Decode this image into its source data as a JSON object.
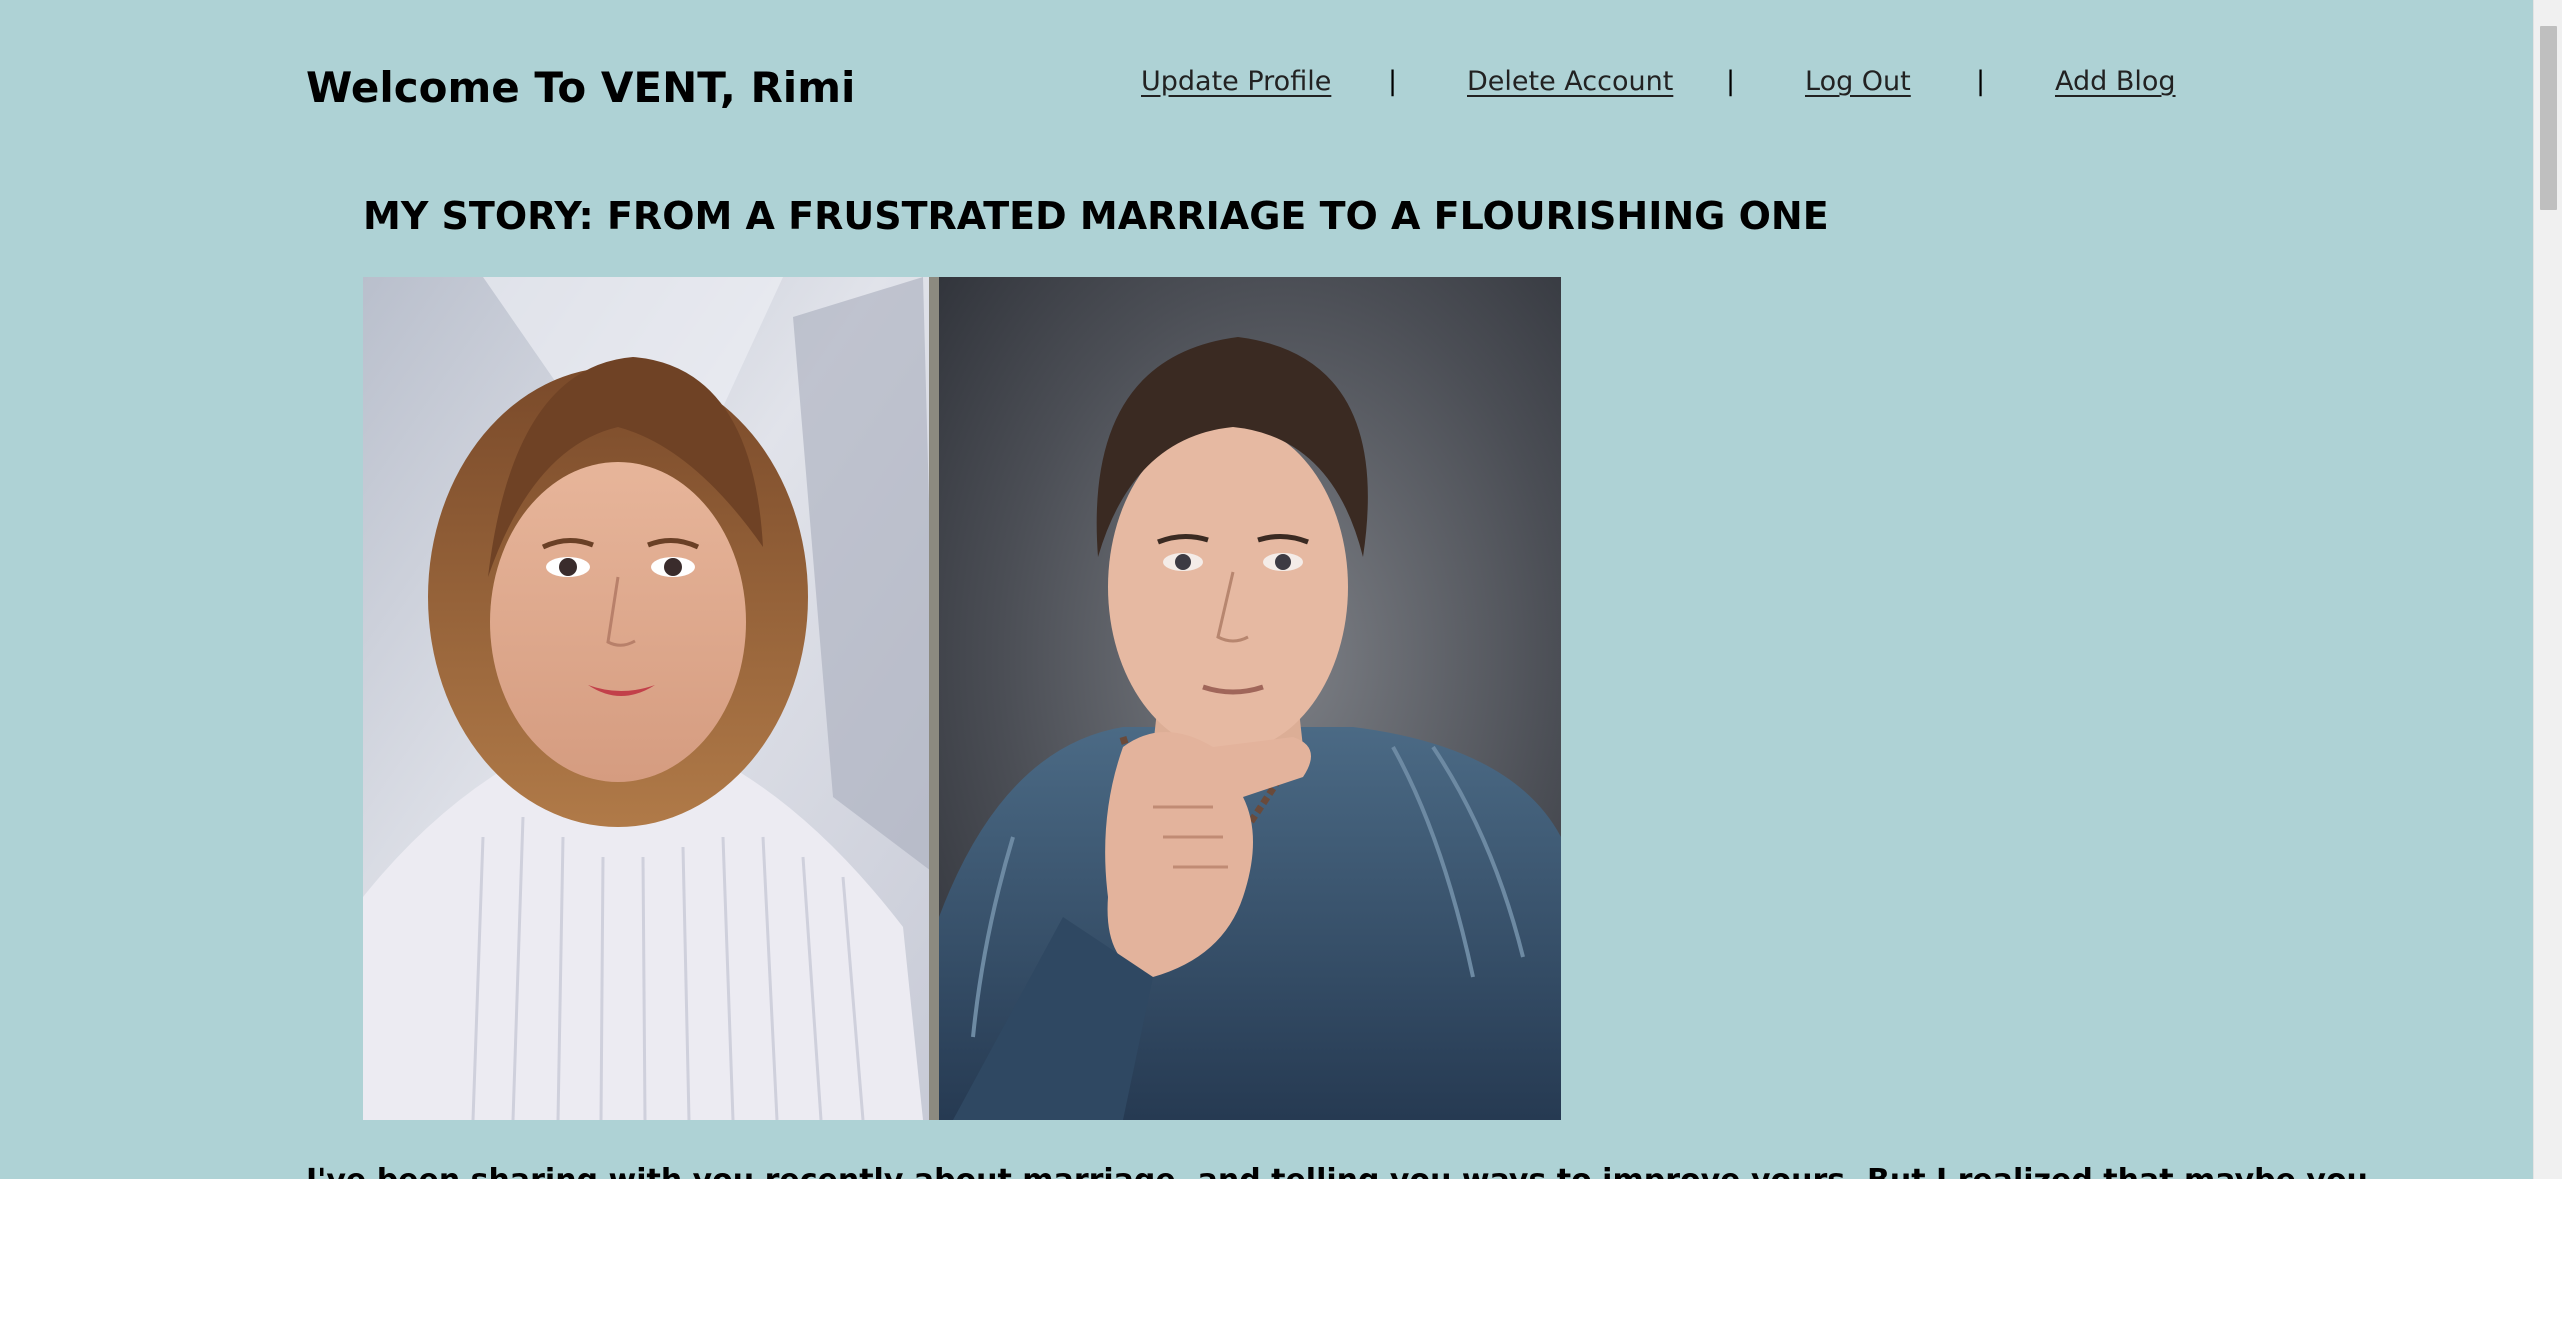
{
  "header": {
    "title": "Welcome To VENT, Rimi",
    "nav": {
      "update_profile": "Update Profile",
      "delete_account": "Delete Account",
      "log_out": "Log Out",
      "add_blog": "Add Blog",
      "separator": "|"
    }
  },
  "blog": {
    "title": "MY STORY: FROM A FRUSTRATED MARRIAGE TO A FLOURISHING ONE",
    "image_alt": "",
    "excerpt": "I've been sharing with you recently about marriage, and telling you ways to improve yours. But I realized that maybe you"
  },
  "colors": {
    "page_background": "#aed2d5",
    "text": "#000000",
    "link": "#222222"
  }
}
